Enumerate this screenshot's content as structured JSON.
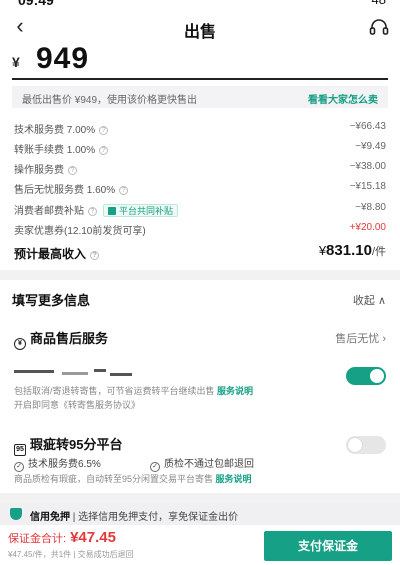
{
  "status": {
    "time": "09:49",
    "battery": "48"
  },
  "header": {
    "back_icon": "back-arrow-icon",
    "title": "出售",
    "support_icon": "headset-icon"
  },
  "price": {
    "currency": "¥",
    "value": "949"
  },
  "tip": {
    "text": "最低出售价 ¥949，使用该价格更快售出",
    "link": "看看大家怎么卖"
  },
  "fees": [
    {
      "label": "技术服务费 7.00%",
      "value": "−¥66.43"
    },
    {
      "label": "转账手续费 1.00%",
      "value": "−¥9.49"
    },
    {
      "label": "操作服务费",
      "value": "−¥38.00"
    },
    {
      "label": "售后无忧服务费 1.60%",
      "value": "−¥15.18"
    },
    {
      "label": "消费者邮费补贴",
      "tag": "平台共同补贴",
      "value": "−¥8.80"
    },
    {
      "label": "卖家优惠券(12.10前发货可享)",
      "value": "+¥20.00"
    }
  ],
  "income": {
    "label": "预计最高收入",
    "currency": "¥",
    "value": "831.10",
    "unit": "/件"
  },
  "more": {
    "title": "填写更多信息",
    "collapse_label": "收起",
    "after_sale": {
      "title": "商品售后服务",
      "right": "售后无忧"
    },
    "shipping": {
      "desc_line1": "包括取消/寄退转寄售，可节省运费转平台继续出售",
      "desc_link": "服务说明",
      "desc_line2": "开启即同意《转寄售服务协议》",
      "toggle_on": true
    },
    "flaw": {
      "title": "瑕疵转95分平台",
      "item1": "技术服务费6.5%",
      "item2": "质检不通过包邮退回",
      "desc": "商品质检有瑕疵，自动转至95分闲置交易平台寄售",
      "desc_link": "服务说明",
      "toggle_on": false
    }
  },
  "credit": {
    "bold": "信用免押",
    "text": "| 选择信用免押支付，享免保证金出价"
  },
  "bottom": {
    "deposit_label": "保证金合计:",
    "deposit_value": "¥47.45",
    "sub": "¥47.45/件，共1件 | 交易成功后退回",
    "pay_button": "支付保证金"
  },
  "colors": {
    "accent": "#16a085",
    "red": "#e4393c"
  }
}
